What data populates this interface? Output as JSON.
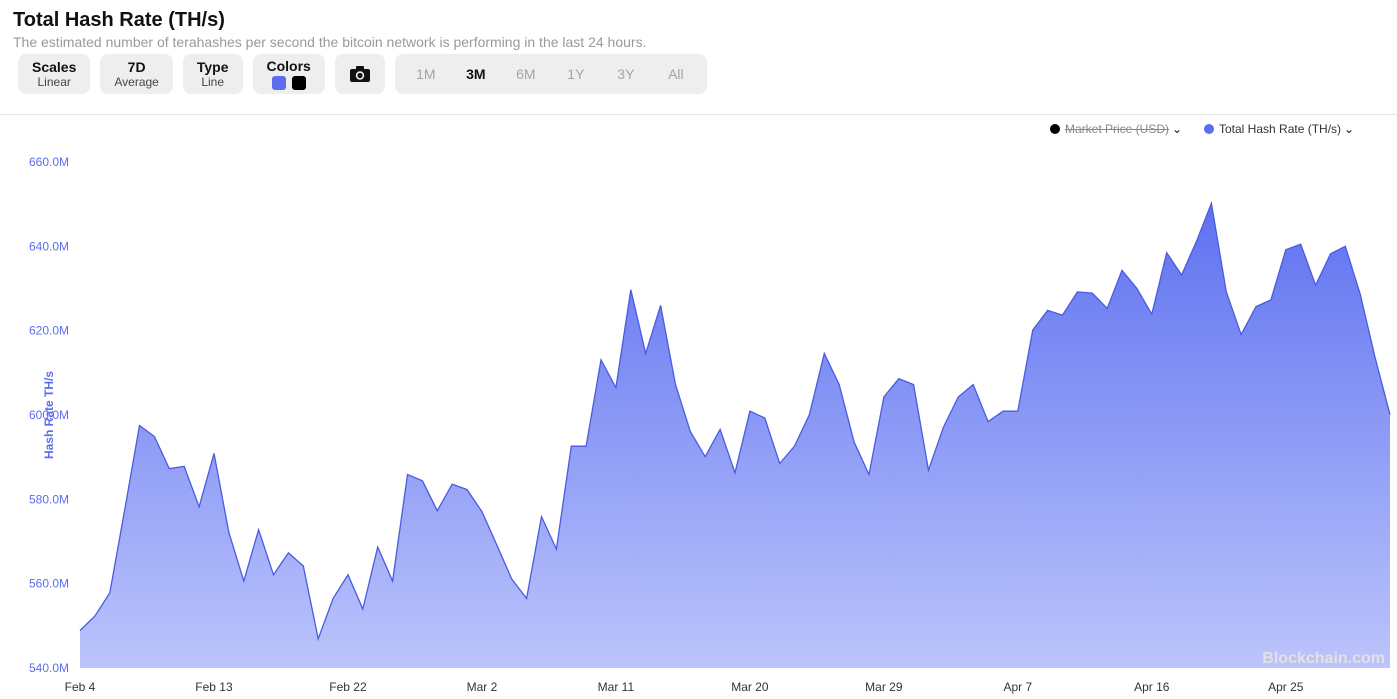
{
  "header": {
    "title": "Total Hash Rate (TH/s)",
    "subtitle": "The estimated number of terahashes per second the bitcoin network is performing in the last 24 hours."
  },
  "toolbar": {
    "scales": {
      "label": "Scales",
      "value": "Linear"
    },
    "average": {
      "label": "7D",
      "value": "Average"
    },
    "type": {
      "label": "Type",
      "value": "Line"
    },
    "colors": {
      "label": "Colors",
      "swatch_1": "#5b6ef0",
      "swatch_2": "#000000"
    },
    "camera_icon": "camera-icon",
    "ranges": [
      "1M",
      "3M",
      "6M",
      "1Y",
      "3Y",
      "All"
    ],
    "active_range": "3M"
  },
  "legend": {
    "market_price": {
      "label": "Market Price (USD)",
      "color": "#000000",
      "enabled": false
    },
    "hash_rate": {
      "label": "Total Hash Rate (TH/s)",
      "color": "#5b6ef0",
      "enabled": true
    }
  },
  "watermark": "Blockchain.com",
  "chart_data": {
    "type": "area",
    "ylabel": "Hash Rate TH/s",
    "ylim": [
      540,
      660
    ],
    "y_tick_labels": [
      "540.0M",
      "560.0M",
      "580.0M",
      "600.0M",
      "620.0M",
      "640.0M",
      "660.0M"
    ],
    "x_tick_labels": [
      "Feb 4",
      "Feb 13",
      "Feb 22",
      "Mar 2",
      "Mar 11",
      "Mar 20",
      "Mar 29",
      "Apr 7",
      "Apr 16",
      "Apr 25"
    ],
    "x_start_label": "Feb 4",
    "x_range_days": [
      0,
      88
    ],
    "series": [
      {
        "name": "Total Hash Rate (TH/s)",
        "color": "#5b6ef0",
        "x": [
          0,
          1,
          2,
          3,
          4,
          5,
          6,
          7,
          8,
          9,
          10,
          11,
          12,
          13,
          14,
          15,
          16,
          17,
          18,
          19,
          20,
          21,
          22,
          23,
          24,
          25,
          26,
          27,
          28,
          29,
          30,
          31,
          32,
          33,
          34,
          35,
          36,
          37,
          38,
          39,
          40,
          41,
          42,
          43,
          44,
          45,
          46,
          47,
          48,
          49,
          50,
          51,
          52,
          53,
          54,
          55,
          56,
          57,
          58,
          59,
          60,
          61,
          62,
          63,
          64,
          65,
          66,
          67,
          68,
          69,
          70,
          71,
          72,
          73,
          74,
          75,
          76,
          77,
          78,
          79,
          80,
          81,
          82,
          83,
          84,
          85,
          86,
          87,
          88
        ],
        "values": [
          548.9,
          552.3,
          557.8,
          577.5,
          597.5,
          594.9,
          587.3,
          587.8,
          578.2,
          590.9,
          572.1,
          560.6,
          572.8,
          562.1,
          567.3,
          564.2,
          546.9,
          556.5,
          562.1,
          554.0,
          568.7,
          560.6,
          585.9,
          584.4,
          577.3,
          583.6,
          582.3,
          577.1,
          569.2,
          561.1,
          556.5,
          575.9,
          568.2,
          592.6,
          592.6,
          613.1,
          606.5,
          629.7,
          614.6,
          626.0,
          607.2,
          596.1,
          590.1,
          596.6,
          586.3,
          600.9,
          599.3,
          588.5,
          592.6,
          600.1,
          614.6,
          607.2,
          593.6,
          585.9,
          604.3,
          608.6,
          607.2,
          586.9,
          597.1,
          604.3,
          607.2,
          598.4,
          600.9,
          600.9,
          620.1,
          624.8,
          623.7,
          629.2,
          628.9,
          625.3,
          634.3,
          630.0,
          623.9,
          638.5,
          633.2,
          641.2,
          650.2,
          629.2,
          619.1,
          625.7,
          627.3,
          639.2,
          640.5,
          630.8,
          638.2,
          640.0,
          628.7,
          613.6,
          600.1
        ]
      }
    ],
    "grid": false,
    "legend_position": "top-right"
  }
}
